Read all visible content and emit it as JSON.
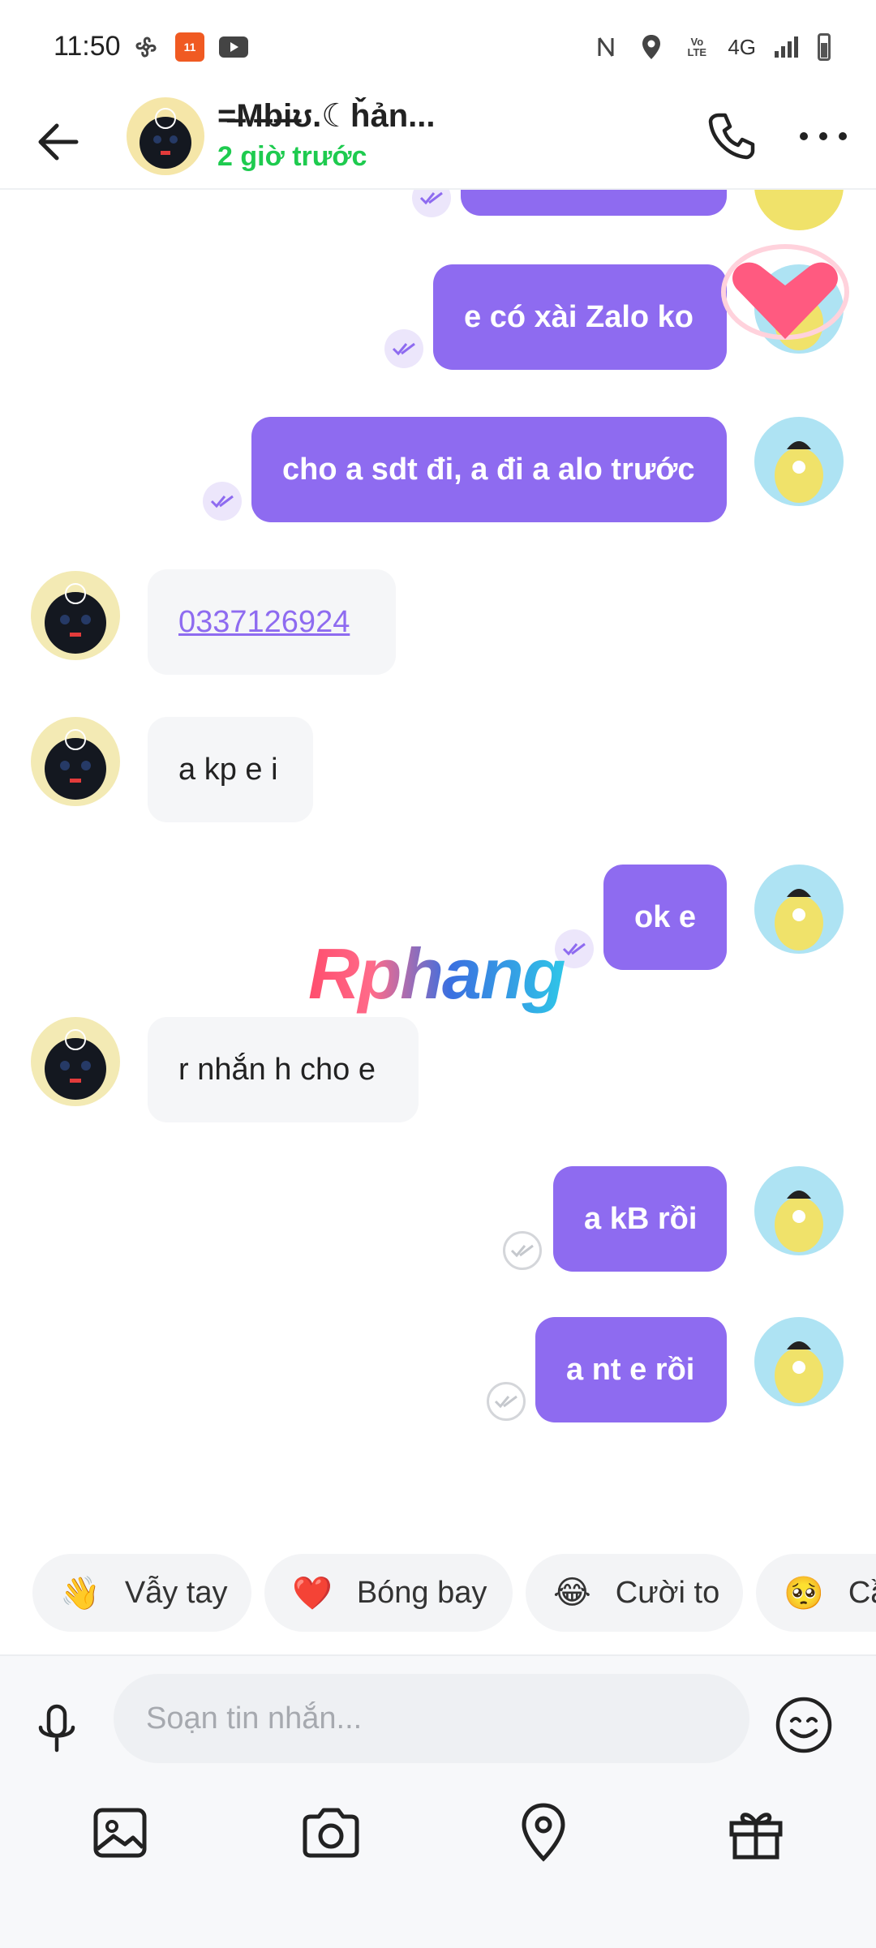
{
  "status_bar": {
    "time": "11:50",
    "network": "4G"
  },
  "header": {
    "contact_name": "=̶̶M̶b̶i̶ʊ.☾ȟản...",
    "last_seen": "2 giờ trước"
  },
  "messages": [
    {
      "dir": "out",
      "text": "e có xài Zalo ko",
      "status": "sent"
    },
    {
      "dir": "out",
      "text": "cho a sdt đi, a đi a alo trước",
      "status": "sent"
    },
    {
      "dir": "in",
      "text": "0337126924",
      "is_link": true
    },
    {
      "dir": "in",
      "text": "a kp e i"
    },
    {
      "dir": "out",
      "text": "ok e",
      "status": "sent"
    },
    {
      "dir": "in",
      "text": "r nhắn h cho e"
    },
    {
      "dir": "out",
      "text": "a kB rồi",
      "status": "received"
    },
    {
      "dir": "out",
      "text": "a nt e rồi",
      "status": "received"
    }
  ],
  "watermark": "Rphang",
  "quick_replies": [
    {
      "emoji": "👋",
      "label": "Vẫy tay"
    },
    {
      "emoji": "❤️",
      "label": "Bóng bay"
    },
    {
      "emoji": "😂",
      "label": "Cười to"
    },
    {
      "emoji": "🥺",
      "label": "Cầ"
    }
  ],
  "composer": {
    "placeholder": "Soạn tin nhắn..."
  },
  "colors": {
    "accent": "#8e6bf0",
    "online": "#1ecb4f"
  },
  "icons": [
    "back-arrow-icon",
    "phone-icon",
    "more-icon",
    "mic-icon",
    "emoji-icon",
    "image-icon",
    "camera-icon",
    "location-icon",
    "gift-icon"
  ]
}
